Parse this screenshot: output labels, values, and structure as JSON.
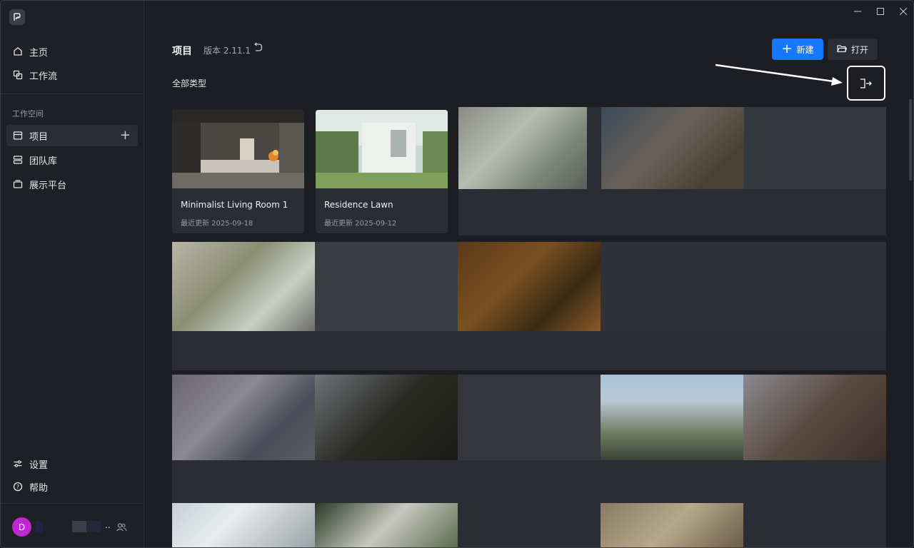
{
  "sidebar": {
    "nav_top": [
      {
        "label": "主页",
        "icon": "home-icon"
      },
      {
        "label": "工作流",
        "icon": "workflow-icon"
      }
    ],
    "section_label": "工作空间",
    "workspace": [
      {
        "label": "项目",
        "icon": "project-icon",
        "active": true
      },
      {
        "label": "团队库",
        "icon": "team-library-icon"
      },
      {
        "label": "展示平台",
        "icon": "showcase-icon"
      }
    ],
    "bottom": [
      {
        "label": "设置",
        "icon": "settings-icon"
      },
      {
        "label": "帮助",
        "icon": "help-icon"
      }
    ],
    "user": {
      "initial": "D",
      "trailing": ".."
    }
  },
  "header": {
    "title": "项目",
    "version": "版本 2.11.1",
    "filter": "全部类型",
    "new_label": "新建",
    "open_label": "打开"
  },
  "projects": [
    {
      "name": "Minimalist Living Room 1",
      "updated": "最近更新 2025-09-18"
    },
    {
      "name": "Residence Lawn",
      "updated": "最近更新 2025-09-12"
    }
  ],
  "colors": {
    "accent": "#1677ff",
    "avatar": "#c026d3"
  }
}
